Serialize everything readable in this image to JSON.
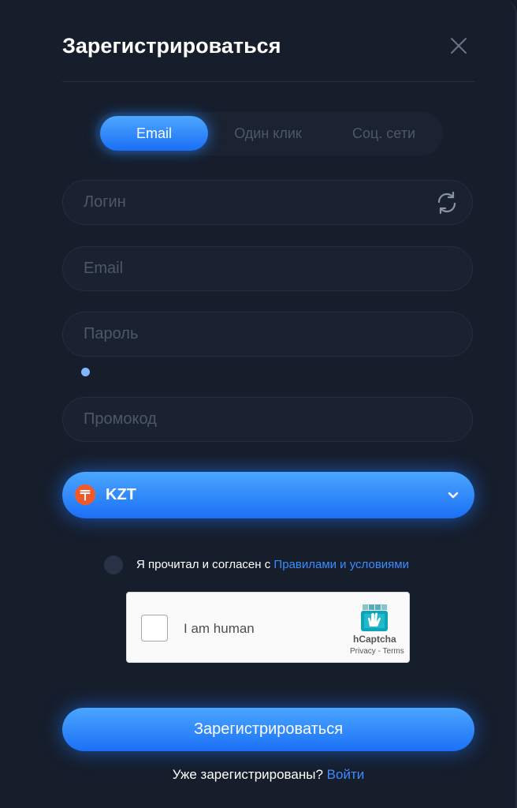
{
  "title": "Зарегистрироваться",
  "tabs": [
    {
      "label": "Email",
      "active": true
    },
    {
      "label": "Один клик",
      "active": false
    },
    {
      "label": "Соц. сети",
      "active": false
    }
  ],
  "fields": {
    "login": {
      "placeholder": "Логин",
      "value": ""
    },
    "email": {
      "placeholder": "Email",
      "value": ""
    },
    "password": {
      "placeholder": "Пароль",
      "value": ""
    },
    "promo": {
      "placeholder": "Промокод",
      "value": ""
    }
  },
  "currency": {
    "label": "KZT",
    "icon": "tenge-icon",
    "icon_color": "#f05a2a"
  },
  "agreement": {
    "text": "Я прочитал и согласен с",
    "link": "Правилами и условиями"
  },
  "captcha": {
    "label": "I am human",
    "brand": "hCaptcha",
    "privacy": "Privacy",
    "separator": " - ",
    "terms": "Terms"
  },
  "submit_label": "Зарегистрироваться",
  "footer": {
    "text": "Уже зарегистрированы?",
    "link": "Войти"
  },
  "colors": {
    "accent": "#1b70f6",
    "link": "#3d8cff",
    "background": "#161d2b"
  }
}
